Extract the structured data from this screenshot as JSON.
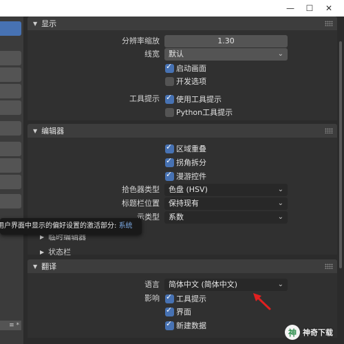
{
  "window": {
    "minimize": "—",
    "maximize": "☐",
    "close": "✕"
  },
  "sidebar": {
    "bottom_label": "≡ *"
  },
  "display_panel": {
    "title": "显示",
    "resolution_scale_label": "分辨率缩放",
    "resolution_scale_value": "1.30",
    "line_width_label": "线宽",
    "line_width_value": "默认",
    "splash_label": "启动画面",
    "splash_checked": true,
    "dev_extras_label": "开发选项",
    "dev_extras_checked": false,
    "tooltips_label": "工具提示",
    "use_tooltips_label": "使用工具提示",
    "use_tooltips_checked": true,
    "python_tooltips_label": "Python工具提示",
    "python_tooltips_checked": false
  },
  "editors_panel": {
    "title": "编辑器",
    "region_overlap_label": "区域重叠",
    "region_overlap_checked": true,
    "corner_split_label": "拐角拆分",
    "corner_split_checked": true,
    "nav_controls_label": "漫游控件",
    "nav_controls_checked": true,
    "color_picker_label": "拾色器类型",
    "color_picker_value": "色盘 (HSV)",
    "header_pos_label": "标题栏位置",
    "header_pos_value": "保持现有",
    "factor_label": "系数类型",
    "factor_label_visible": "示类型",
    "factor_value": "系数",
    "temp_editors_label": "临时编辑器",
    "status_bar_label": "状态栏"
  },
  "tooltip": {
    "text": "用户界面中显示的偏好设置的激活部分: ",
    "accent": "系统"
  },
  "translation_panel": {
    "title": "翻译",
    "language_label": "语言",
    "language_value": "简体中文 (简体中文)",
    "affect_label": "影响",
    "tooltips_label": "工具提示",
    "tooltips_checked": true,
    "interface_label": "界面",
    "interface_checked": true,
    "new_data_label": "新建数据",
    "new_data_checked": true
  },
  "watermark": {
    "icon": "神",
    "text": "神奇下载"
  },
  "colors": {
    "accent": "#4772b3",
    "arrow": "#e02020"
  }
}
